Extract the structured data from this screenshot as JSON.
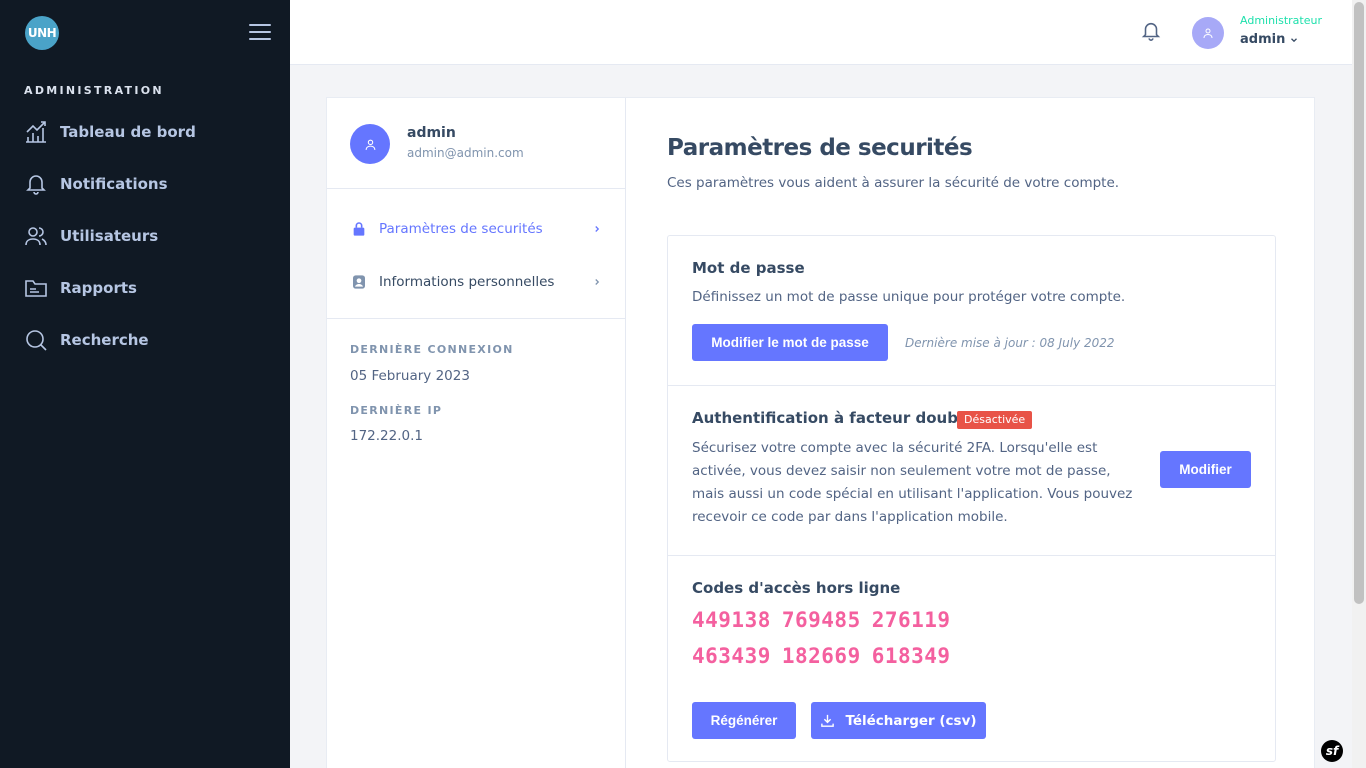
{
  "sidebar": {
    "logo_text": "UNH",
    "section_title": "ADMINISTRATION",
    "items": [
      {
        "label": "Tableau de bord",
        "icon": "chart-bar-icon"
      },
      {
        "label": "Notifications",
        "icon": "bell-icon"
      },
      {
        "label": "Utilisateurs",
        "icon": "users-icon"
      },
      {
        "label": "Rapports",
        "icon": "folder-icon"
      },
      {
        "label": "Recherche",
        "icon": "search-icon"
      }
    ]
  },
  "header": {
    "user_role": "Administrateur",
    "user_name": "admin"
  },
  "profile": {
    "name": "admin",
    "email": "admin@admin.com",
    "menu": [
      {
        "label": "Paramètres de securités",
        "icon": "lock-icon",
        "active": true
      },
      {
        "label": "Informations personnelles",
        "icon": "user-card-icon",
        "active": false
      }
    ],
    "last_login_title": "DERNIÈRE CONNEXION",
    "last_login_value": "05 February 2023",
    "last_ip_title": "DERNIÈRE IP",
    "last_ip_value": "172.22.0.1"
  },
  "main": {
    "title": "Paramètres de securités",
    "subtitle": "Ces paramètres vous aident à assurer la sécurité de votre compte.",
    "password": {
      "title": "Mot de passe",
      "text": "Définissez un mot de passe unique pour protéger votre compte.",
      "button": "Modifier le mot de passe",
      "note": "Dernière mise à jour : 08 July 2022"
    },
    "twofa": {
      "title": "Authentification à facteur double",
      "badge": "Désactivée",
      "text": "Sécurisez votre compte avec la sécurité 2FA. Lorsqu'elle est activée, vous devez saisir non seulement votre mot de passe, mais aussi un code spécial en utilisant l'application. Vous pouvez recevoir ce code par dans l'application mobile.",
      "button": "Modifier"
    },
    "offline_codes": {
      "title": "Codes d'accès hors ligne",
      "codes": [
        "449138",
        "769485",
        "276119",
        "463439",
        "182669",
        "618349"
      ],
      "regenerate_button": "Régénérer",
      "download_button": "Télécharger (csv)"
    }
  },
  "colors": {
    "accent": "#6576ff",
    "sidebar_bg": "#101924",
    "danger": "#e85347",
    "code_color": "#f4609f",
    "success": "#1ee0ac"
  },
  "symfony_badge": "sf"
}
